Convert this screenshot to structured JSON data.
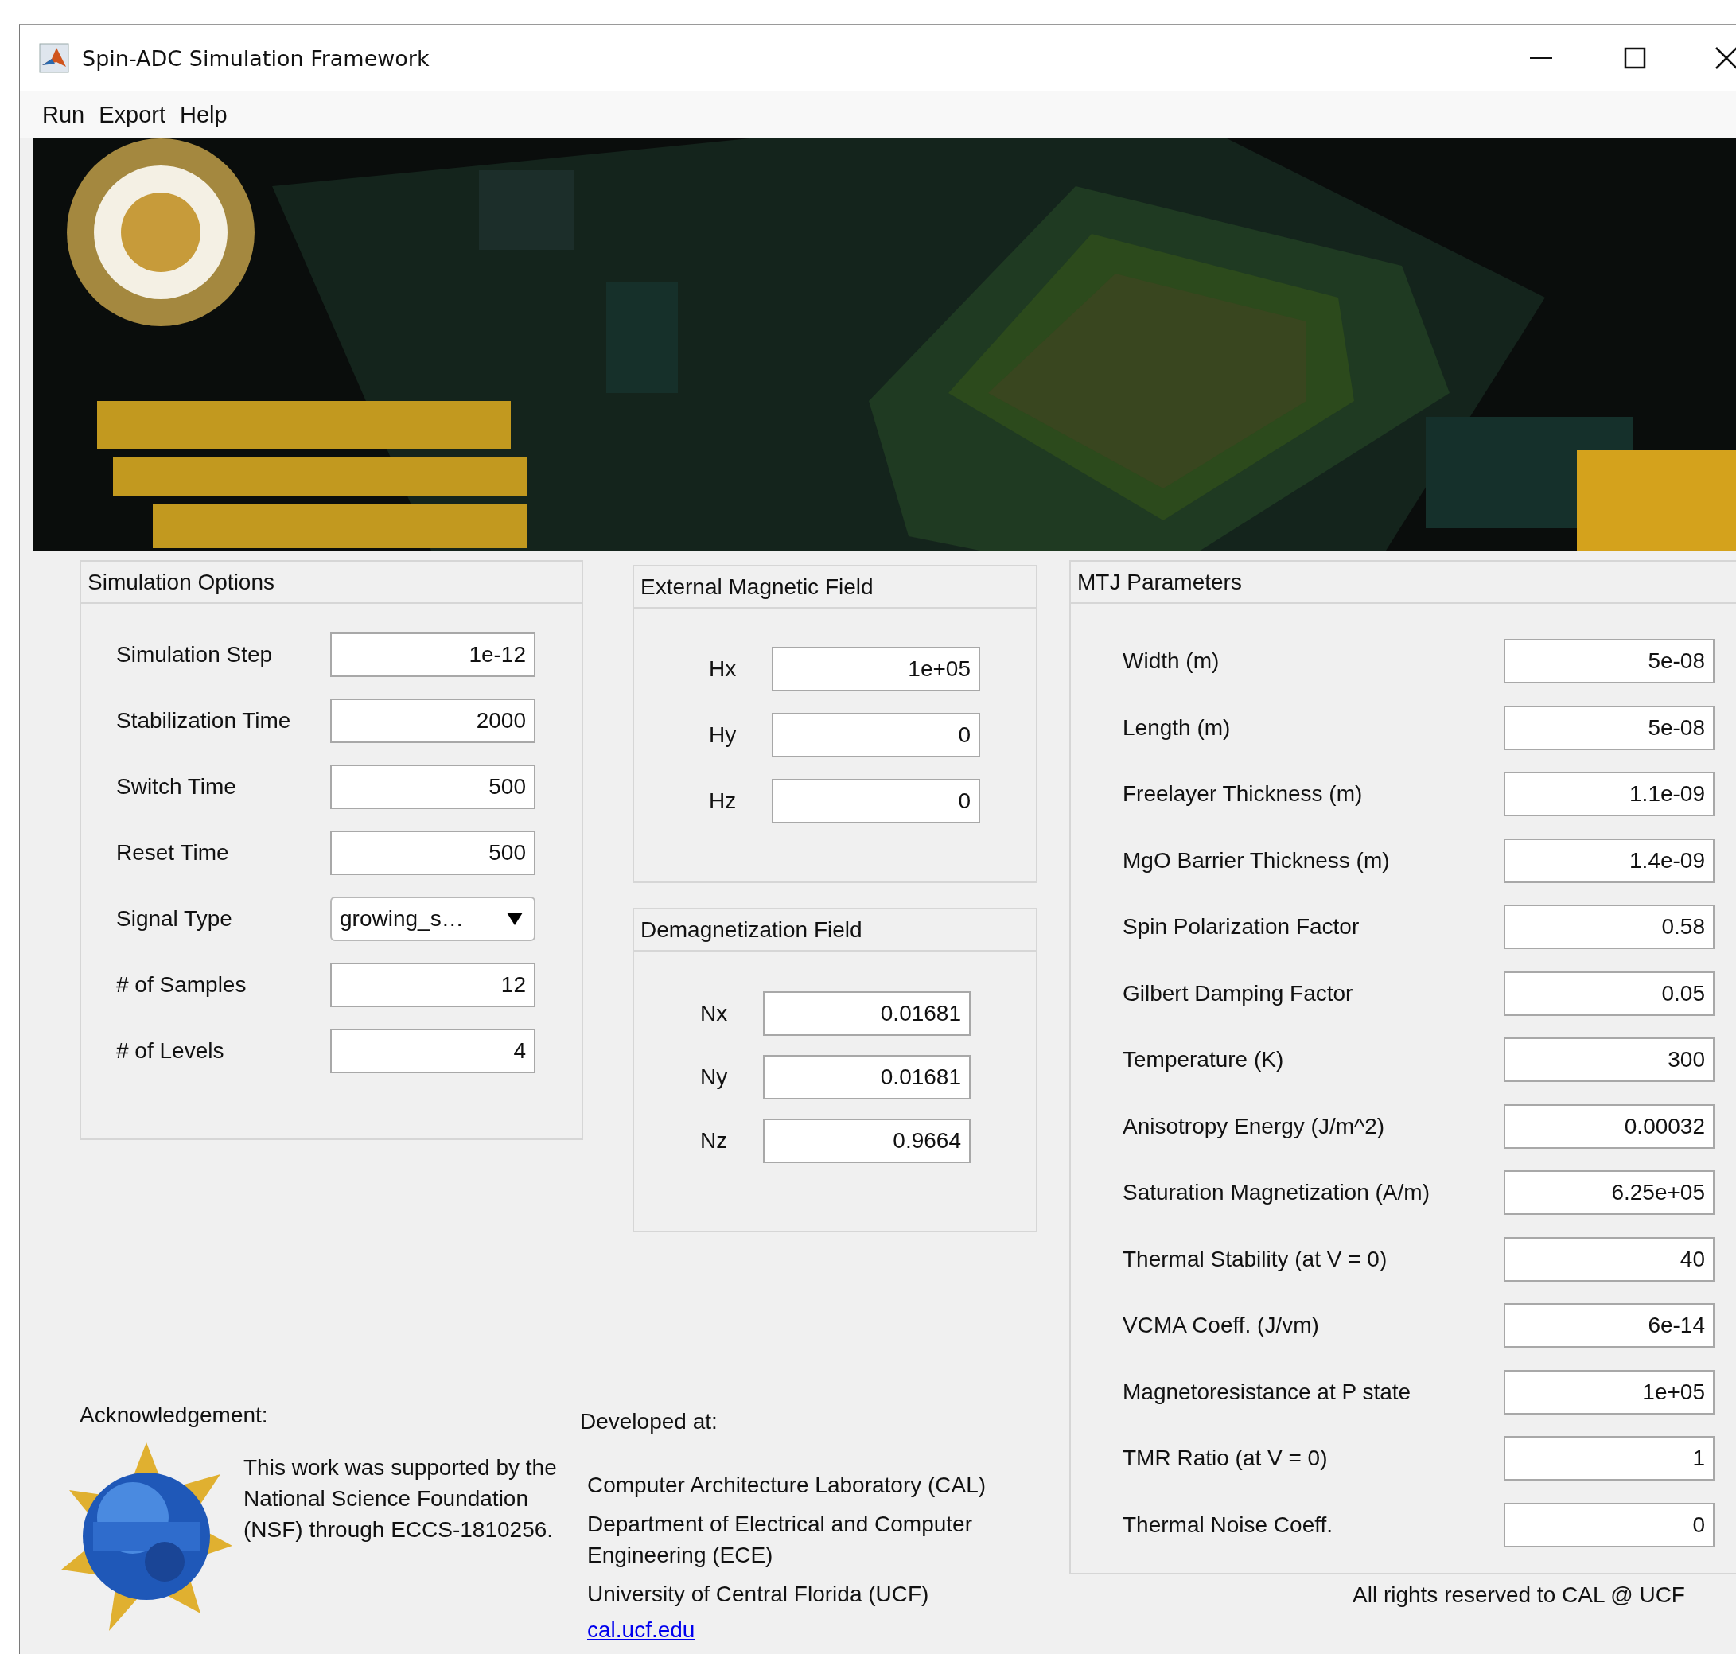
{
  "window": {
    "title": "Spin-ADC Simulation Framework"
  },
  "menu": [
    "Run",
    "Export",
    "Help"
  ],
  "simulation_options": {
    "title": "Simulation Options",
    "fields": [
      {
        "label": "Simulation Step",
        "value": "1e-12",
        "kind": "text"
      },
      {
        "label": "Stabilization Time",
        "value": "2000",
        "kind": "text"
      },
      {
        "label": "Switch Time",
        "value": "500",
        "kind": "text"
      },
      {
        "label": "Reset Time",
        "value": "500",
        "kind": "text"
      },
      {
        "label": "Signal Type",
        "value": "growing_s…",
        "kind": "dropdown"
      },
      {
        "label": "# of Samples",
        "value": "12",
        "kind": "text"
      },
      {
        "label": "# of Levels",
        "value": "4",
        "kind": "text"
      }
    ]
  },
  "external_magnetic_field": {
    "title": "External Magnetic Field",
    "fields": [
      {
        "label": "Hx",
        "value": "1e+05",
        "kind": "text"
      },
      {
        "label": "Hy",
        "value": "0",
        "kind": "text"
      },
      {
        "label": "Hz",
        "value": "0",
        "kind": "text"
      }
    ]
  },
  "demagnetization_field": {
    "title": "Demagnetization Field",
    "fields": [
      {
        "label": "Nx",
        "value": "0.01681",
        "kind": "text"
      },
      {
        "label": "Ny",
        "value": "0.01681",
        "kind": "text"
      },
      {
        "label": "Nz",
        "value": "0.9664",
        "kind": "text"
      }
    ]
  },
  "mtj_parameters": {
    "title": "MTJ Parameters",
    "fields": [
      {
        "label": "Width (m)",
        "value": "5e-08",
        "kind": "text"
      },
      {
        "label": "Length (m)",
        "value": "5e-08",
        "kind": "text"
      },
      {
        "label": "Freelayer Thickness (m)",
        "value": "1.1e-09",
        "kind": "text"
      },
      {
        "label": "MgO Barrier Thickness (m)",
        "value": "1.4e-09",
        "kind": "text"
      },
      {
        "label": "Spin Polarization Factor",
        "value": "0.58",
        "kind": "text"
      },
      {
        "label": "Gilbert Damping Factor",
        "value": "0.05",
        "kind": "text"
      },
      {
        "label": "Temperature (K)",
        "value": "300",
        "kind": "text"
      },
      {
        "label": "Anisotropy Energy (J/m^2)",
        "value": "0.00032",
        "kind": "text"
      },
      {
        "label": "Saturation Magnetization (A/m)",
        "value": "6.25e+05",
        "kind": "text"
      },
      {
        "label": "Thermal Stability (at V = 0)",
        "value": "40",
        "kind": "text"
      },
      {
        "label": "VCMA Coeff. (J/vm)",
        "value": "6e-14",
        "kind": "text"
      },
      {
        "label": "Magnetoresistance at P state",
        "value": "1e+05",
        "kind": "text"
      },
      {
        "label": "TMR Ratio (at V = 0)",
        "value": "1",
        "kind": "text"
      },
      {
        "label": "Thermal Noise Coeff.",
        "value": "0",
        "kind": "text"
      }
    ]
  },
  "acknowledgement": {
    "title": "Acknowledgement:",
    "text": "This work was supported by the National Science Foundation (NSF) through ECCS-1810256."
  },
  "developed_at": {
    "title": "Developed at:",
    "lines": [
      "Computer Architecture Laboratory (CAL)",
      "Department of Electrical and Computer Engineering (ECE)",
      "University of Central Florida (UCF)"
    ],
    "link": "cal.ucf.edu"
  },
  "footer": "All rights reserved to CAL @ UCF"
}
